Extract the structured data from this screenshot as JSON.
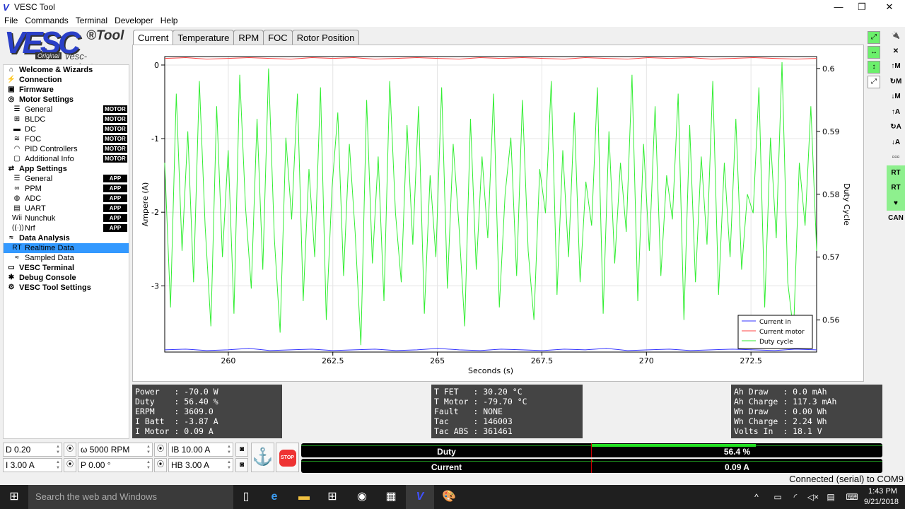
{
  "window": {
    "title": "VESC Tool",
    "minimize": "—",
    "maximize": "❐",
    "close": "✕"
  },
  "menu": [
    "File",
    "Commands",
    "Terminal",
    "Developer",
    "Help"
  ],
  "brand": {
    "logo": "VESC",
    "tool": "®Tool",
    "original": "Original",
    "site": "vesc-project.com"
  },
  "sidebar": [
    {
      "label": "Welcome & Wizards",
      "icon": "home-icon",
      "glyph": "⌂",
      "level": 0
    },
    {
      "label": "Connection",
      "icon": "plug-icon",
      "glyph": "⚡",
      "level": 0
    },
    {
      "label": "Firmware",
      "icon": "chip-icon",
      "glyph": "▣",
      "level": 0
    },
    {
      "label": "Motor Settings",
      "icon": "motor-icon",
      "glyph": "◎",
      "level": 0
    },
    {
      "label": "General",
      "icon": "sliders-icon",
      "glyph": "☰",
      "level": 1,
      "badge": "MOTOR"
    },
    {
      "label": "BLDC",
      "icon": "bldc-icon",
      "glyph": "⊞",
      "level": 1,
      "badge": "MOTOR"
    },
    {
      "label": "DC",
      "icon": "battery-icon",
      "glyph": "▬",
      "level": 1,
      "badge": "MOTOR"
    },
    {
      "label": "FOC",
      "icon": "foc-icon",
      "glyph": "≋",
      "level": 1,
      "badge": "MOTOR"
    },
    {
      "label": "PID Controllers",
      "icon": "gauge-icon",
      "glyph": "◠",
      "level": 1,
      "badge": "MOTOR"
    },
    {
      "label": "Additional Info",
      "icon": "info-icon",
      "glyph": "▢",
      "level": 1,
      "badge": "MOTOR"
    },
    {
      "label": "App Settings",
      "icon": "app-icon",
      "glyph": "⇄",
      "level": 0
    },
    {
      "label": "General",
      "icon": "sliders-icon",
      "glyph": "☰",
      "level": 1,
      "badge": "APP"
    },
    {
      "label": "PPM",
      "icon": "ppm-icon",
      "glyph": "∞",
      "level": 1,
      "badge": "APP"
    },
    {
      "label": "ADC",
      "icon": "adc-icon",
      "glyph": "◍",
      "level": 1,
      "badge": "APP"
    },
    {
      "label": "UART",
      "icon": "uart-icon",
      "glyph": "▤",
      "level": 1,
      "badge": "APP"
    },
    {
      "label": "Nunchuk",
      "icon": "wii-icon",
      "glyph": "Wii",
      "level": 1,
      "badge": "APP"
    },
    {
      "label": "Nrf",
      "icon": "wireless-icon",
      "glyph": "((·))",
      "level": 1,
      "badge": "APP"
    },
    {
      "label": "Data Analysis",
      "icon": "analysis-icon",
      "glyph": "≈",
      "level": 0
    },
    {
      "label": "Realtime Data",
      "icon": "realtime-icon",
      "glyph": "RT",
      "level": 1,
      "selected": true
    },
    {
      "label": "Sampled Data",
      "icon": "sampled-icon",
      "glyph": "≈",
      "level": 1
    },
    {
      "label": "VESC Terminal",
      "icon": "terminal-icon",
      "glyph": "▭",
      "level": 0
    },
    {
      "label": "Debug Console",
      "icon": "bug-icon",
      "glyph": "✱",
      "level": 0
    },
    {
      "label": "VESC Tool Settings",
      "icon": "gear-icon",
      "glyph": "⚙",
      "level": 0
    }
  ],
  "tabs": [
    {
      "label": "Current",
      "active": true
    },
    {
      "label": "Temperature"
    },
    {
      "label": "RPM"
    },
    {
      "label": "FOC"
    },
    {
      "label": "Rotor Position"
    }
  ],
  "chart_data": {
    "type": "line",
    "xlabel": "Seconds (s)",
    "ylabel": "Ampere (A)",
    "y2label": "Duty Cycle",
    "xlim": [
      258.48,
      274.07
    ],
    "ylim": [
      -3.9,
      0.115
    ],
    "y2lim": [
      0.5549,
      0.6019
    ],
    "xticks": [
      260,
      262.5,
      265,
      267.5,
      270,
      272.5
    ],
    "xtick_labels": [
      "260",
      "262.5",
      "265",
      "267.5",
      "270",
      "272.5"
    ],
    "yticks": [
      0,
      -1,
      -2,
      -3
    ],
    "ytick_labels": [
      "0",
      "-1",
      "-2",
      "-3"
    ],
    "y2ticks": [
      0.6,
      0.59,
      0.58,
      0.57,
      0.56
    ],
    "y2tick_labels": [
      "0.6",
      "0.59",
      "0.58",
      "0.57",
      "0.56"
    ],
    "grid": true,
    "legend": "bottom-right",
    "series": [
      {
        "name": "Current in",
        "axis": "left",
        "color": "#3333ff",
        "values": [
          -3.87,
          -3.86,
          -3.88,
          -3.87,
          -3.85,
          -3.88,
          -3.87,
          -3.86,
          -3.88,
          -3.87,
          -3.86,
          -3.88,
          -3.87,
          -3.85,
          -3.87,
          -3.88,
          -3.86,
          -3.87,
          -3.88,
          -3.86,
          -3.87,
          -3.85,
          -3.88,
          -3.87,
          -3.86,
          -3.88,
          -3.87,
          -3.86,
          -3.87,
          -3.88,
          -3.86,
          -3.87
        ]
      },
      {
        "name": "Current motor",
        "axis": "left",
        "color": "#ff4444",
        "values": [
          0.09,
          0.1,
          0.08,
          0.09,
          0.1,
          0.09,
          0.08,
          0.1,
          0.09,
          0.1,
          0.08,
          0.09,
          0.1,
          0.09,
          0.08,
          0.1,
          0.09,
          0.1,
          0.09,
          0.08,
          0.1,
          0.09,
          0.08,
          0.1,
          0.09,
          0.1,
          0.08,
          0.09,
          0.1,
          0.09,
          0.08,
          0.09
        ]
      },
      {
        "name": "Duty cycle",
        "axis": "right",
        "color": "#33ee33",
        "values": [
          0.585,
          0.562,
          0.596,
          0.571,
          0.59,
          0.566,
          0.598,
          0.575,
          0.559,
          0.594,
          0.57,
          0.587,
          0.561,
          0.599,
          0.578,
          0.565,
          0.592,
          0.568,
          0.6,
          0.573,
          0.558,
          0.589,
          0.576,
          0.596,
          0.563,
          0.584,
          0.57,
          0.597,
          0.56,
          0.581,
          0.593,
          0.567,
          0.588,
          0.574,
          0.556,
          0.595,
          0.569,
          0.586,
          0.563,
          0.598,
          0.577,
          0.566,
          0.591,
          0.572,
          0.594,
          0.561,
          0.583,
          0.57,
          0.597,
          0.565,
          0.588,
          0.575,
          0.559,
          0.592,
          0.568,
          0.586,
          0.573,
          0.596,
          0.562,
          0.58,
          0.589,
          0.567,
          0.595,
          0.571,
          0.56,
          0.584,
          0.577,
          0.598,
          0.564,
          0.587,
          0.57,
          0.593,
          0.566,
          0.582,
          0.575,
          0.597,
          0.561,
          0.59,
          0.569,
          0.585,
          0.574,
          0.599,
          0.563,
          0.588,
          0.571,
          0.594,
          0.567,
          0.583,
          0.576,
          0.596,
          0.56,
          0.591,
          0.566,
          0.586,
          0.572,
          0.598,
          0.564,
          0.585,
          0.57,
          0.592,
          0.568,
          0.58,
          0.577,
          0.597,
          0.562,
          0.589,
          0.573,
          0.601,
          0.566,
          0.558,
          0.585,
          0.575,
          0.594,
          0.571
        ]
      }
    ]
  },
  "plot_tools": [
    {
      "icon": "zoom-fit-icon",
      "glyph": "⤢"
    },
    {
      "icon": "zoom-horizontal-icon",
      "glyph": "↔"
    },
    {
      "icon": "zoom-vertical-icon",
      "glyph": "↕"
    },
    {
      "icon": "rescale-icon",
      "glyph": "⤢"
    }
  ],
  "right_tools": [
    {
      "icon": "connect-icon",
      "glyph": "🔌"
    },
    {
      "icon": "disconnect-icon",
      "glyph": "✕"
    },
    {
      "icon": "read-motor-icon",
      "glyph": "↑M"
    },
    {
      "icon": "reset-motor-icon",
      "glyph": "↻M"
    },
    {
      "icon": "write-motor-icon",
      "glyph": "↓M"
    },
    {
      "icon": "read-app-icon",
      "glyph": "↑A"
    },
    {
      "icon": "reset-app-icon",
      "glyph": "↻A"
    },
    {
      "icon": "write-app-icon",
      "glyph": "↓A"
    },
    {
      "icon": "can-tree-icon",
      "glyph": "▫▫▫"
    },
    {
      "icon": "realtime-toggle-icon",
      "glyph": "RT"
    },
    {
      "icon": "realtime-app-icon",
      "glyph": "RT"
    },
    {
      "icon": "heartbeat-icon",
      "glyph": "♥"
    },
    {
      "icon": "can-forward-icon",
      "glyph": "CAN"
    }
  ],
  "panels": {
    "left": "Power   : -70.0 W\nDuty    : 56.40 %\nERPM    : 3609.0\nI Batt  : -3.87 A\nI Motor : 0.09 A",
    "mid": "T FET   : 30.20 °C\nT Motor : -79.70 °C\nFault   : NONE\nTac     : 146003\nTac ABS : 361461",
    "right": "Ah Draw   : 0.0 mAh\nAh Charge : 117.3 mAh\nWh Draw   : 0.00 Wh\nWh Charge : 2.24 Wh\nVolts In  : 18.1 V"
  },
  "controls": {
    "duty": "D 0.20",
    "rpm": "ω 5000 RPM",
    "brake": "IB 10.00 A",
    "current": "I 3.00 A",
    "position": "P 0.00 °",
    "handbrake": "HB 3.00 A",
    "anchor": "⚓",
    "stop": "STOP"
  },
  "bars": {
    "duty_label": "Duty",
    "duty_value": "56.4 %",
    "duty_percent": 56.4,
    "current_label": "Current",
    "current_value": "0.09 A",
    "current_percent": 0.1
  },
  "status": "Connected (serial) to COM9",
  "taskbar": {
    "search": "Search the web and Windows",
    "time": "1:43 PM",
    "date": "9/21/2018"
  }
}
